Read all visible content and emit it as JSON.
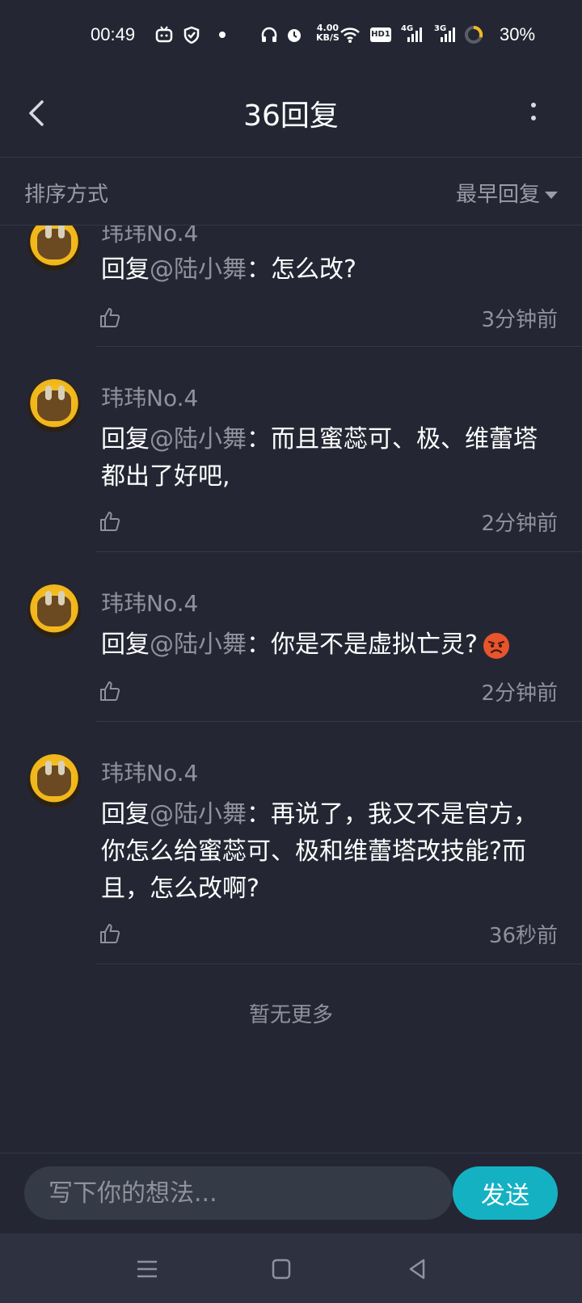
{
  "status_bar": {
    "time": "00:49",
    "speed_value": "4.00",
    "speed_unit": "KB/S",
    "network_1": "4G",
    "network_2": "3G",
    "hd_badge": "HD1",
    "battery": "30%",
    "icons": [
      "tv-icon",
      "shield-icon",
      "dot-icon",
      "headphones-icon",
      "alarm-icon",
      "wifi-icon",
      "hd-icon",
      "signal-icon",
      "signal-icon",
      "battery-icon"
    ]
  },
  "header": {
    "title": "36回复",
    "back_icon": "chevron-left-icon",
    "more_icon": "more-vertical-icon"
  },
  "sort": {
    "label": "排序方式",
    "selected": "最早回复"
  },
  "replies": [
    {
      "username": "玮玮No.4",
      "prefix": "回复",
      "mention": "@陆小舞",
      "text": "：怎么改?",
      "time": "3分钟前"
    },
    {
      "username": "玮玮No.4",
      "prefix": "回复",
      "mention": "@陆小舞",
      "text": "：而且蜜蕊可、极、维蕾塔都出了好吧,",
      "time": "2分钟前"
    },
    {
      "username": "玮玮No.4",
      "prefix": "回复",
      "mention": "@陆小舞",
      "text": "：你是不是虚拟亡灵?",
      "emoji": "angry-face-emoji",
      "time": "2分钟前"
    },
    {
      "username": "玮玮No.4",
      "prefix": "回复",
      "mention": "@陆小舞",
      "text": "：再说了，我又不是官方，你怎么给蜜蕊可、极和维蕾塔改技能?而且，怎么改啊?",
      "time": "36秒前"
    }
  ],
  "footer_note": "暂无更多",
  "composer": {
    "placeholder": "写下你的想法...",
    "send_label": "发送"
  },
  "colors": {
    "background": "#242733",
    "accent": "#14b1c3",
    "muted_text": "#8f929c"
  }
}
